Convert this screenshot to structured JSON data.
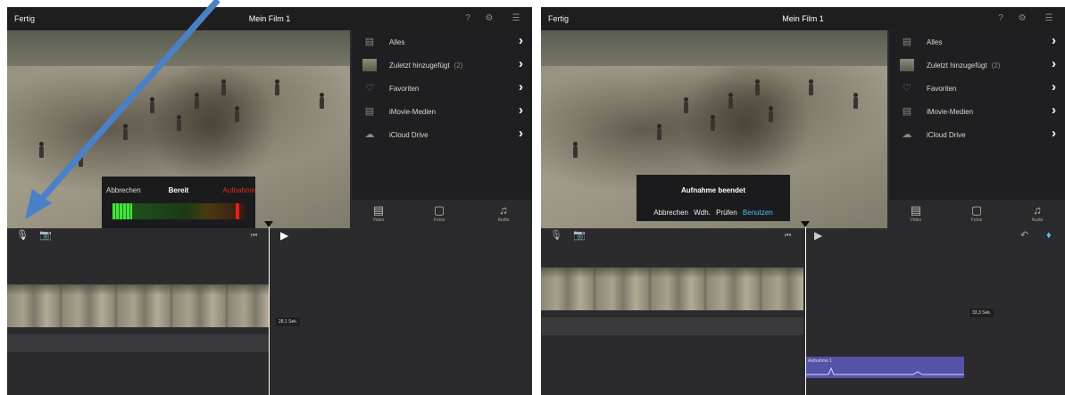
{
  "left": {
    "topbar": {
      "done_label": "Fertig",
      "title": "Mein Film 1"
    },
    "media": {
      "items": [
        {
          "label": "Alles",
          "count": "",
          "icon": "film-icon"
        },
        {
          "label": "Zuletzt hinzugefügt",
          "count": "(2)",
          "icon": "thumbnail-icon"
        },
        {
          "label": "Favoriten",
          "count": "",
          "icon": "heart-icon"
        },
        {
          "label": "iMovie-Medien",
          "count": "",
          "icon": "film-icon"
        },
        {
          "label": "iCloud Drive",
          "count": "",
          "icon": "cloud-icon"
        }
      ],
      "tabs": [
        "Video",
        "Fotos",
        "Audio"
      ]
    },
    "recorder": {
      "cancel_label": "Abbrechen",
      "status_label": "Bereit",
      "record_label": "Aufnahme"
    },
    "clip_duration": "28,1 Sek."
  },
  "right": {
    "topbar": {
      "done_label": "Fertig",
      "title": "Mein Film 1"
    },
    "media": {
      "items": [
        {
          "label": "Alles",
          "count": "",
          "icon": "film-icon"
        },
        {
          "label": "Zuletzt hinzugefügt",
          "count": "(2)",
          "icon": "thumbnail-icon"
        },
        {
          "label": "Favoriten",
          "count": "",
          "icon": "heart-icon"
        },
        {
          "label": "iMovie-Medien",
          "count": "",
          "icon": "film-icon"
        },
        {
          "label": "iCloud Drive",
          "count": "",
          "icon": "cloud-icon"
        }
      ],
      "tabs": [
        "Video",
        "Fotos",
        "Audio"
      ]
    },
    "recording_done": {
      "title": "Aufnahme beendet",
      "cancel_label": "Abbrechen",
      "retake_label": "Wdh.",
      "review_label": "Prüfen",
      "use_label": "Benutzen"
    },
    "clip_duration": "33,3 Sek.",
    "audio_clip_label": "Aufnahme 1"
  },
  "colors": {
    "accent": "#4bc3ee",
    "record_red": "#e0261a",
    "audio_clip": "#5552a8",
    "arrow": "#4a80c8"
  }
}
